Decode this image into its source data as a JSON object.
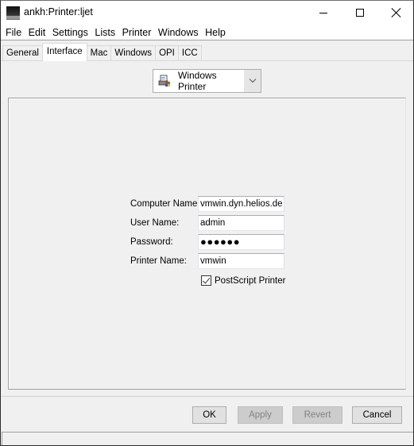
{
  "window": {
    "title": "ankh:Printer:ljet",
    "app_icon": "helios-app-icon",
    "controls": [
      "minimize",
      "maximize",
      "close"
    ]
  },
  "menubar": {
    "items": [
      "File",
      "Edit",
      "Settings",
      "Lists",
      "Printer",
      "Windows",
      "Help"
    ]
  },
  "tabs": {
    "items": [
      "General",
      "Interface",
      "Mac",
      "Windows",
      "OPI",
      "ICC"
    ],
    "active": "Interface"
  },
  "interface_type": {
    "selected": "Windows Printer",
    "icon": "windows-printer-icon"
  },
  "form": {
    "computer_name": {
      "label": "Computer Name:",
      "value": "vmwin.dyn.helios.de"
    },
    "user_name": {
      "label": "User Name:",
      "value": "admin"
    },
    "password": {
      "label": "Password:",
      "value": "●●●●●●"
    },
    "printer_name": {
      "label": "Printer Name:",
      "value": "vmwin"
    },
    "postscript_printer": {
      "label": "PostScript Printer",
      "checked": true
    }
  },
  "buttons": {
    "ok": {
      "label": "OK",
      "enabled": true
    },
    "apply": {
      "label": "Apply",
      "enabled": false
    },
    "revert": {
      "label": "Revert",
      "enabled": false
    },
    "cancel": {
      "label": "Cancel",
      "enabled": true
    }
  },
  "statusbar": {
    "text": ""
  }
}
